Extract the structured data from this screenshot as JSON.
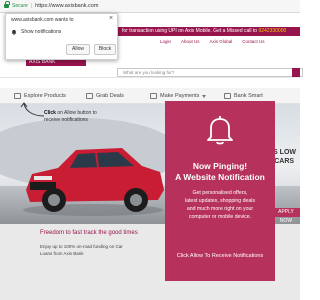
{
  "browser": {
    "secure_label": "Secure",
    "separator": "|",
    "url": "https://www.axisbank.com"
  },
  "permission_popup": {
    "origin": "www.axisbank.com wants to",
    "request": "Show notifications",
    "allow_label": "Allow",
    "block_label": "Block",
    "close_glyph": "×"
  },
  "site": {
    "ticker_text": "for transaction using UPI on Axis Mobile. Get a Missed call to ",
    "ticker_number": "9242330000",
    "logo_peek": "AXIS BANK",
    "topnav": [
      "Login",
      "About Us",
      "Axis Global",
      "Contact Us"
    ],
    "search_placeholder": "What are you looking for?",
    "mainnav": [
      "Explore Products",
      "Grab Deals",
      "Make Payments",
      "Bank Smart"
    ],
    "pointer_bold": "Click",
    "pointer_line1": " on Allow button to",
    "pointer_line2": "receive notifications",
    "promo_line1": "NS LOW",
    "promo_line2": "T CARS",
    "apply_label": "APPLY NOW",
    "below_title": "Freedom to fast track the good times",
    "below_line1": "Enjoy up to 100% on-road funding on Car",
    "below_line2": "Loans from Axis Bank"
  },
  "card": {
    "title_line1": "Now Pinging!",
    "title_line2": "A Website Notification",
    "body_lines": [
      "Get personalised offers,",
      "latest updates, shopping deals",
      "and much more right on your",
      "computer or mobile device."
    ],
    "cta": "Click Allow To Receive Notifications"
  },
  "colors": {
    "brand": "#97144d",
    "card": "#b6325c",
    "secure": "#1e8e3e",
    "car": "#c81d33"
  },
  "icons": [
    "lock-icon",
    "bell-icon",
    "close-icon",
    "arrow-icon",
    "search-icon"
  ]
}
